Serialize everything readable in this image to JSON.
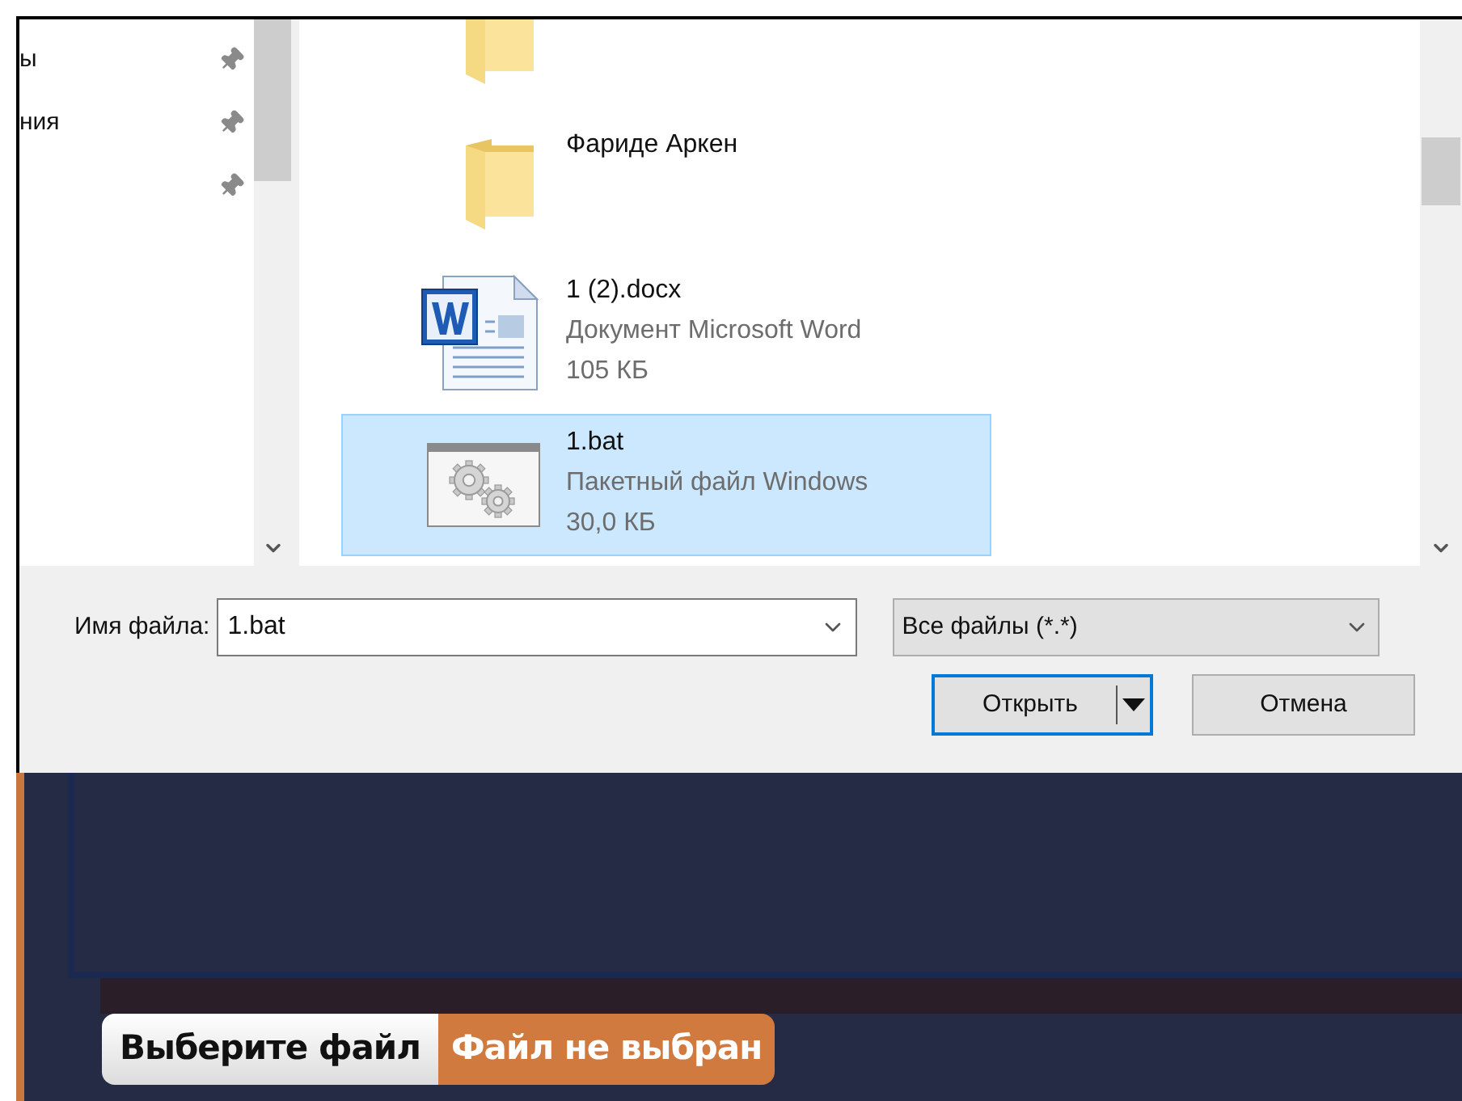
{
  "nav_items": [
    {
      "kind": "labeled",
      "label": "ы"
    },
    {
      "kind": "labeled",
      "label": "ния"
    },
    {
      "kind": "unlabeled"
    }
  ],
  "files": [
    {
      "kind": "folder",
      "selected": false
    },
    {
      "kind": "folder",
      "name": "Фариде Аркен",
      "selected": false
    },
    {
      "kind": "word",
      "name": "1 (2).docx",
      "type": "Документ Microsoft Word",
      "size": "105 КБ",
      "selected": false
    },
    {
      "kind": "batch",
      "name": "1.bat",
      "type": "Пакетный файл Windows",
      "size": "30,0 КБ",
      "selected": true
    }
  ],
  "file_name": {
    "label": "Имя файла:",
    "value": "1.bat"
  },
  "file_type": {
    "value": "Все файлы (*.*)"
  },
  "buttons": {
    "open": "Открыть",
    "cancel": "Отмена"
  },
  "file_input": {
    "button": "Выберите файл",
    "status": "Файл не выбран"
  }
}
